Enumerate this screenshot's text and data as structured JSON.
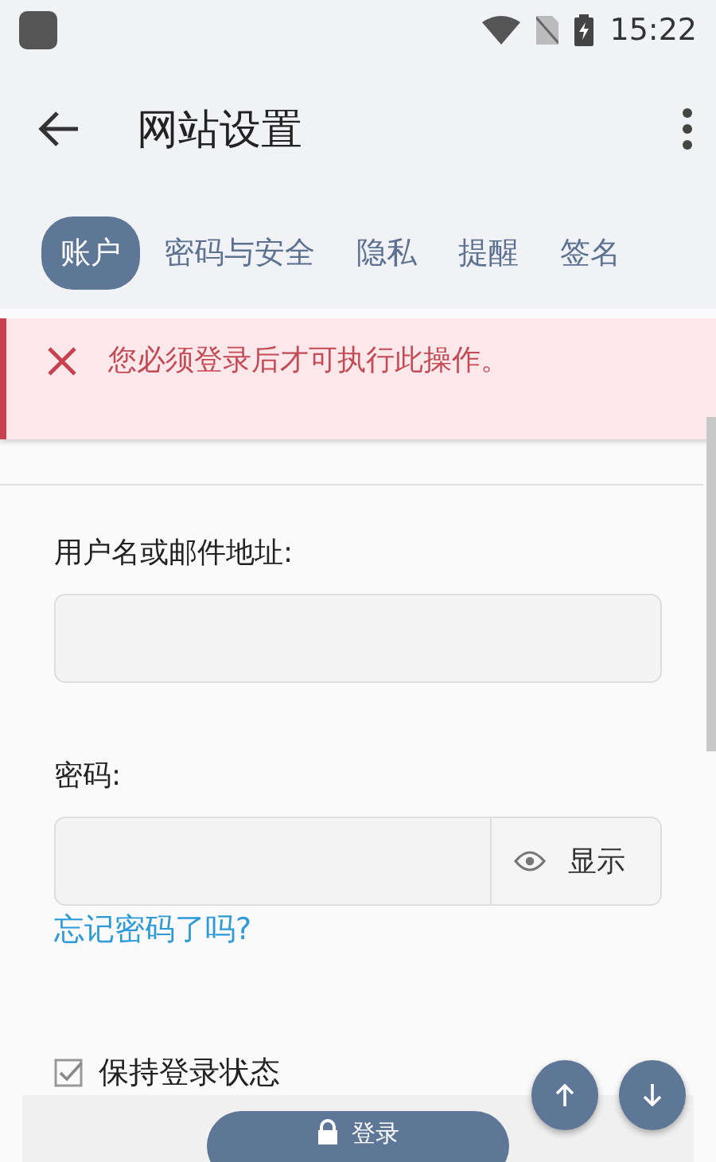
{
  "status_bar": {
    "time": "15:22"
  },
  "toolbar": {
    "title": "网站设置"
  },
  "tabs": [
    {
      "label": "账户",
      "selected": true
    },
    {
      "label": "密码与安全",
      "selected": false
    },
    {
      "label": "隐私",
      "selected": false
    },
    {
      "label": "提醒",
      "selected": false
    },
    {
      "label": "签名",
      "selected": false
    }
  ],
  "alert": {
    "message": "您必须登录后才可执行此操作。"
  },
  "form": {
    "username_label": "用户名或邮件地址:",
    "password_label": "密码:",
    "show_button": "显示",
    "forgot_link": "忘记密码了吗?",
    "remember": {
      "label": "保持登录状态",
      "checked": true
    },
    "login_button": "登录"
  }
}
